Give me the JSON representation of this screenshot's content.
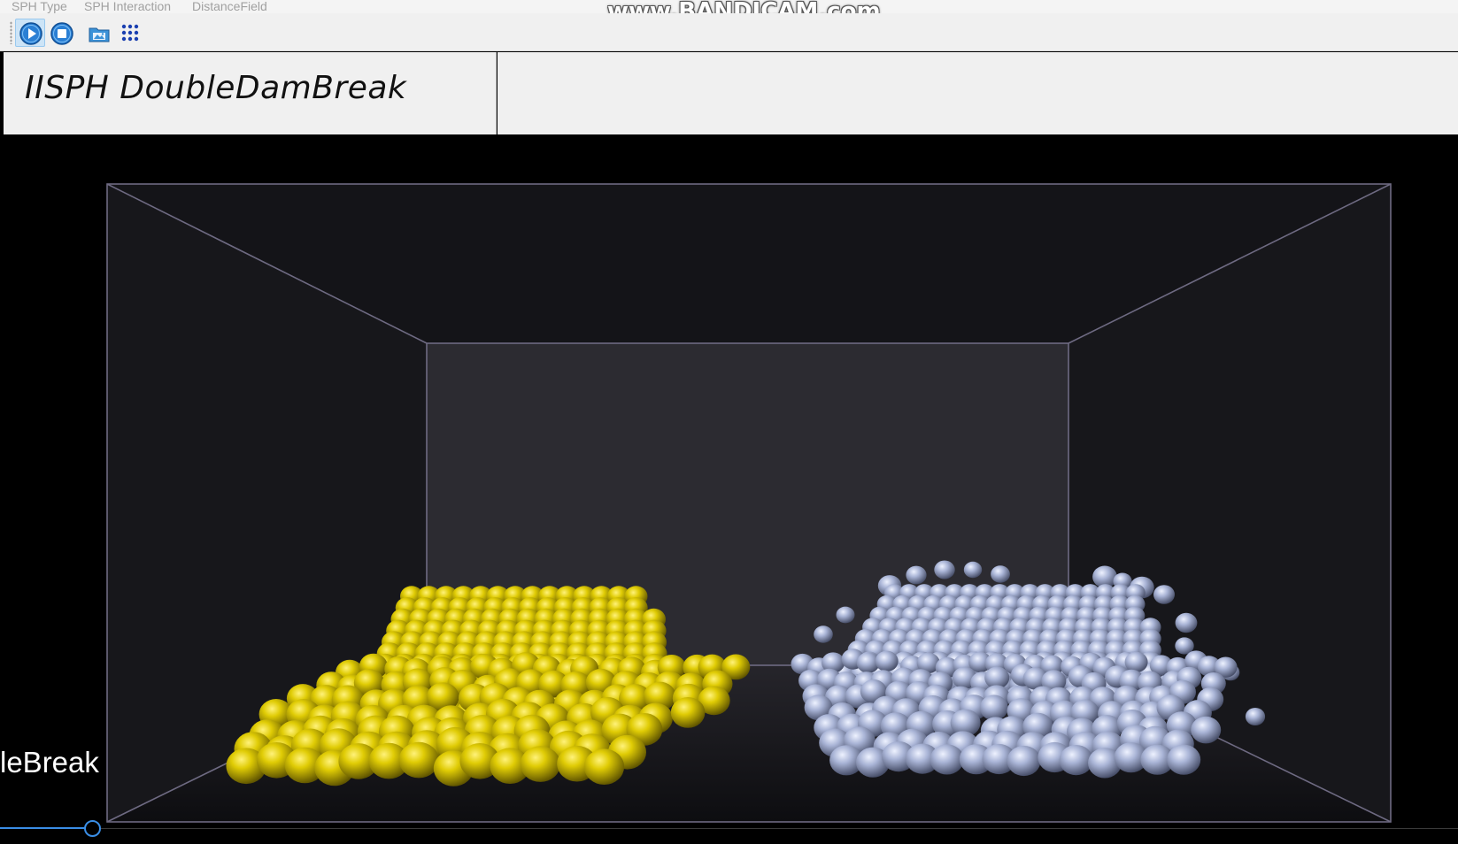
{
  "menu": {
    "items": [
      {
        "label": "SPH Type"
      },
      {
        "label": "SPH Interaction"
      },
      {
        "label": "DistanceField"
      }
    ]
  },
  "watermark": "www.BANDICAM.com",
  "toolbar": {
    "buttons": [
      {
        "icon": "play-icon",
        "active": true
      },
      {
        "icon": "stop-icon",
        "active": false
      },
      {
        "icon": "image-folder-icon",
        "active": false
      },
      {
        "icon": "grid-dots-icon",
        "active": false
      }
    ]
  },
  "panel": {
    "title": "IISPH DoubleDamBreak"
  },
  "scene": {
    "fluids": [
      {
        "name": "yellow-fluid",
        "color": "#d6c400"
      },
      {
        "name": "blue-fluid",
        "color": "#b8c4e6"
      }
    ],
    "box_edge_color": "#6e6a82",
    "back_wall_color": "#2c2b31"
  },
  "overlay": {
    "caption": "leBreak"
  },
  "timeline": {
    "accent": "#3a8ee6"
  }
}
